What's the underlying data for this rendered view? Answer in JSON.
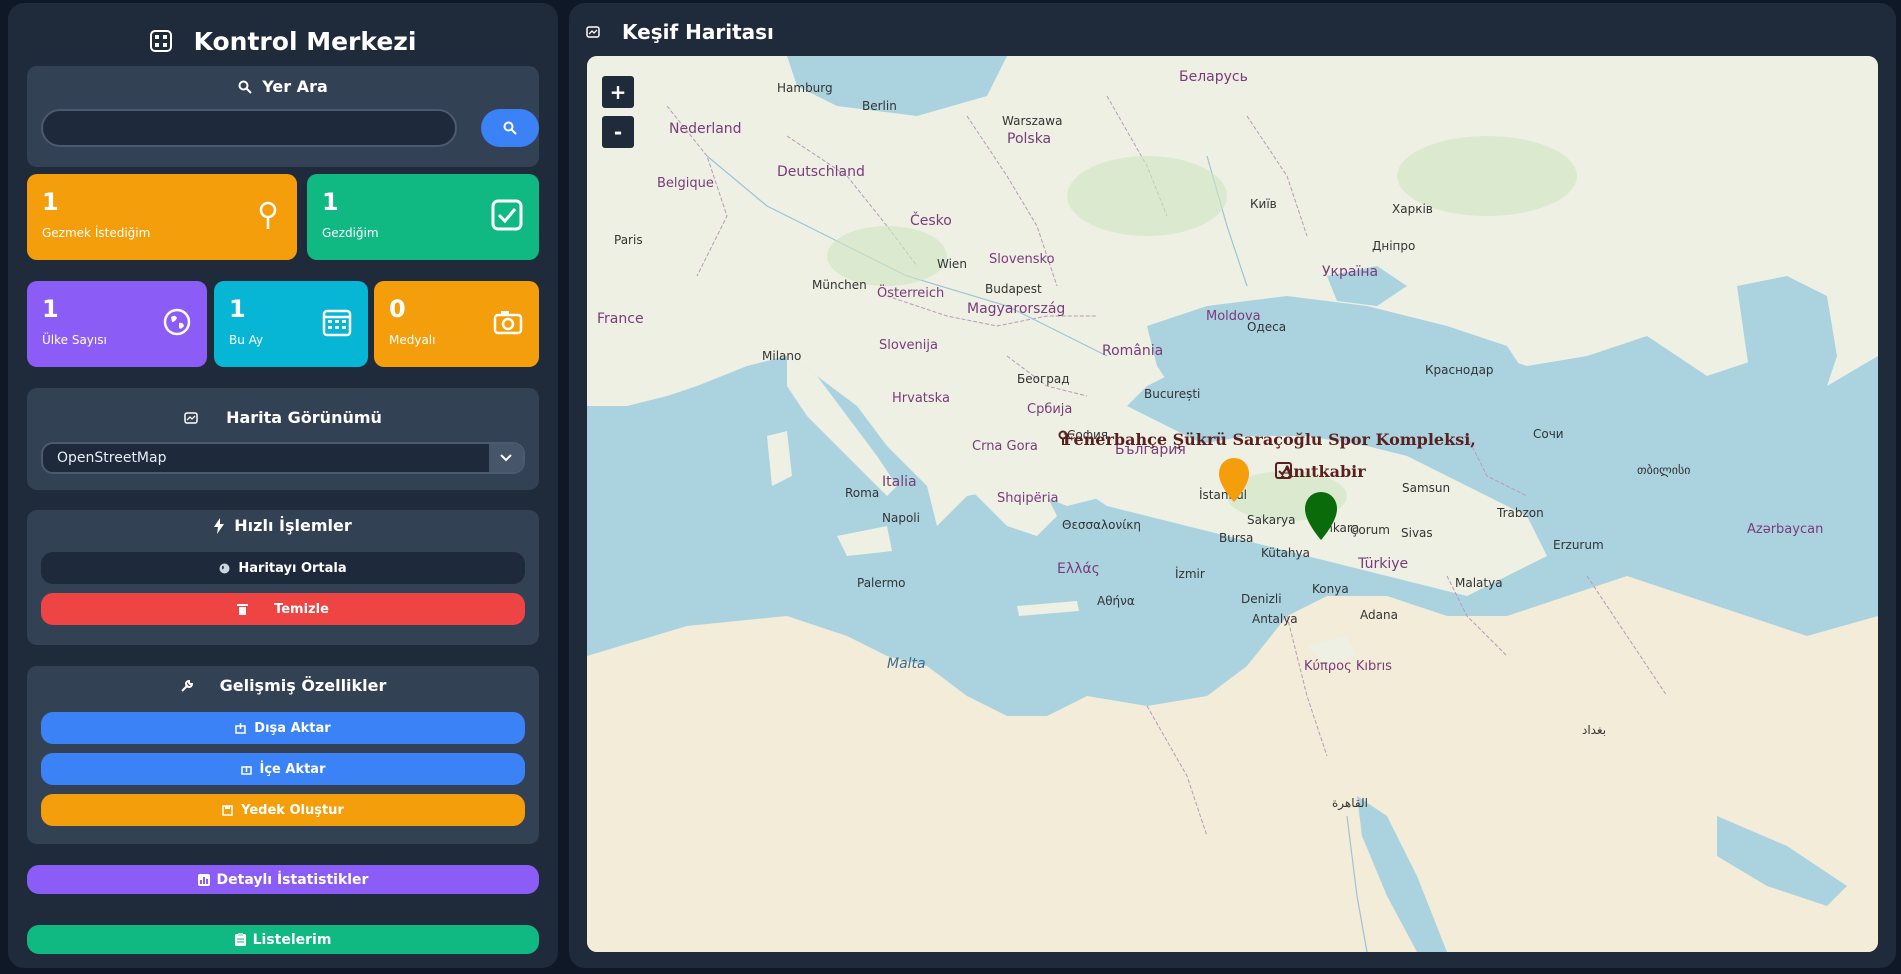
{
  "sidebar": {
    "title": "Kontrol Merkezi",
    "title_icon": "grid-icon",
    "search": {
      "title": "Yer Ara",
      "title_icon": "magnifier-icon",
      "value": "",
      "placeholder": "",
      "button_icon": "magnifier-icon"
    },
    "stats_top": [
      {
        "value": "1",
        "label": "Gezmek İstediğim",
        "icon": "pin-icon",
        "color": "#f59e0b"
      },
      {
        "value": "1",
        "label": "Gezdiğim",
        "icon": "check-square-icon",
        "color": "#10b981"
      }
    ],
    "stats_bottom": [
      {
        "value": "1",
        "label": "Ülke Sayısı",
        "icon": "globe-icon",
        "color": "#8b5cf6"
      },
      {
        "value": "1",
        "label": "Bu Ay",
        "icon": "calendar-icon",
        "color": "#06b6d4"
      },
      {
        "value": "0",
        "label": "Medyalı",
        "icon": "camera-icon",
        "color": "#f59e0b"
      }
    ],
    "map_view": {
      "title": "Harita Görünümü",
      "title_icon": "map-icon",
      "selected": "OpenStreetMap"
    },
    "quick_actions": {
      "title": "Hızlı İşlemler",
      "title_icon": "bolt-icon",
      "center_label": "Haritayı Ortala",
      "clear_label": "Temizle"
    },
    "advanced": {
      "title": "Gelişmiş Özellikler",
      "title_icon": "wrench-icon",
      "export_label": "Dışa Aktar",
      "import_label": "İçe Aktar",
      "backup_label": "Yedek Oluştur"
    },
    "detailed_stats_label": "Detaylı İstatistikler",
    "my_lists_label": "Listelerim"
  },
  "map": {
    "title": "Keşif Haritası",
    "title_icon": "map-icon",
    "zoom_in": "+",
    "zoom_out": "-",
    "markers": [
      {
        "label": "Fenerbahçe Şükrü Saraçoğlu Spor Kompleksi,",
        "status": "Gezmek İstediğim",
        "color": "#f59e0b"
      },
      {
        "label": "Anıtkabir",
        "status": "Gezdiğim",
        "color": "#0a6b0a"
      }
    ],
    "labels": {
      "nederland": "Nederland",
      "deutschland": "Deutschland",
      "belgique": "Belgique",
      "france": "France",
      "polska": "Polska",
      "cesko": "Česko",
      "slovensko": "Slovensko",
      "osterreich": "Österreich",
      "magyarorszag": "Magyarország",
      "romania": "România",
      "bulgaria": "България",
      "srbija": "Србија",
      "italia": "Italia",
      "ellas": "Ελλάς",
      "turkiye": "Türkiye",
      "ukraina": "Україна",
      "belarus": "Беларусь",
      "moldova": "Moldova",
      "hrvatska": "Hrvatska",
      "slovenija": "Slovenija",
      "shqiperia": "Shqipëria",
      "crna_gora": "Crna Gora",
      "azerbaycan": "Azərbaycan",
      "kibris": "Κύπρος Kıbrıs",
      "malta": "Malta",
      "istanbul": "İstanbul",
      "ankara": "Ankara",
      "izmir": "İzmir",
      "konya": "Konya",
      "antalya": "Antalya",
      "samsun": "Samsun",
      "sakarya": "Sakarya",
      "kutahya": "Kütahya",
      "trabzon": "Trabzon",
      "erzurum": "Erzurum",
      "malatya": "Malatya",
      "adana": "Adana",
      "sivas": "Sivas",
      "corum": "Çorum",
      "bursa": "Bursa",
      "denizli": "Denizli",
      "berlin": "Berlin",
      "hamburg": "Hamburg",
      "warszawa": "Warszawa",
      "wien": "Wien",
      "budapest": "Budapest",
      "bucuresti": "București",
      "sofia": "София",
      "beograd": "Београд",
      "roma": "Roma",
      "napoli": "Napoli",
      "milano": "Milano",
      "kyiv": "Київ",
      "paris": "Paris",
      "munchen": "München",
      "odesa": "Одеса",
      "sochi": "Сочи",
      "krasnodar": "Краснодар",
      "athens": "Αθήνα",
      "thessaloniki": "Θεσσαλονίκη",
      "palermo": "Palermo",
      "dnipro": "Дніпро",
      "kharkiv": "Харків",
      "tbilisi": "თბილისი",
      "baghdad": "بغداد",
      "cairo": "القاهرة"
    }
  }
}
